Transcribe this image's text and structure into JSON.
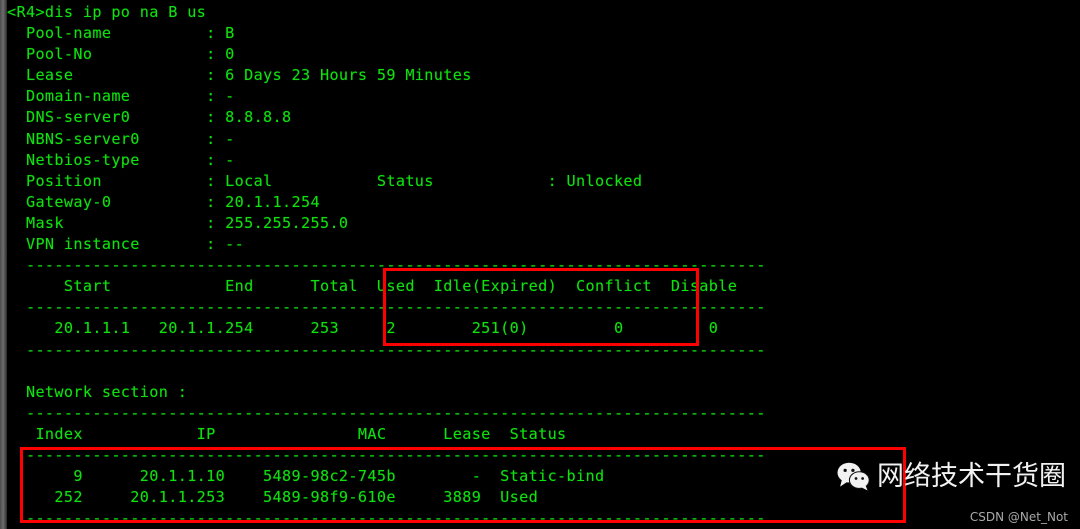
{
  "terminal": {
    "prompt": "<R4>",
    "command": "dis ip po na B us",
    "command_line": "<R4>dis ip po na B us",
    "text_color": "#10e010",
    "background_color": "#000000"
  },
  "pool": {
    "fields": [
      {
        "label": "Pool-name",
        "value": "B"
      },
      {
        "label": "Pool-No",
        "value": "0"
      },
      {
        "label": "Lease",
        "value": "6 Days 23 Hours 59 Minutes"
      },
      {
        "label": "Domain-name",
        "value": "-"
      },
      {
        "label": "DNS-server0",
        "value": "8.8.8.8"
      },
      {
        "label": "NBNS-server0",
        "value": "-"
      },
      {
        "label": "Netbios-type",
        "value": "-"
      },
      {
        "label": "Position",
        "value": "Local"
      },
      {
        "label": "Gateway-0",
        "value": "20.1.1.254"
      },
      {
        "label": "Mask",
        "value": "255.255.255.0"
      },
      {
        "label": "VPN instance",
        "value": "--"
      }
    ],
    "status_label": "Status",
    "status_value": "Unlocked"
  },
  "usage_table": {
    "headers": [
      "Start",
      "End",
      "Total",
      "Used",
      "Idle(Expired)",
      "Conflict",
      "Disable"
    ],
    "rows": [
      {
        "start": "20.1.1.1",
        "end": "20.1.1.254",
        "total": "253",
        "used": "2",
        "idle_expired": "251(0)",
        "conflict": "0",
        "disable": "0"
      }
    ]
  },
  "network_section": {
    "title": "Network section :",
    "headers": [
      "Index",
      "IP",
      "MAC",
      "Lease",
      "Status"
    ],
    "rows": [
      {
        "index": "9",
        "ip": "20.1.1.10",
        "mac": "5489-98c2-745b",
        "lease": "-",
        "status": "Static-bind"
      },
      {
        "index": "252",
        "ip": "20.1.1.253",
        "mac": "5489-98f9-610e",
        "lease": "3889",
        "status": "Used"
      }
    ]
  },
  "annotations": {
    "color": "#fe0000",
    "boxes": [
      {
        "name": "usage-counters-highlight",
        "targets": "Total / Used / Idle(Expired)"
      },
      {
        "name": "network-leases-highlight",
        "targets": "Index / IP / MAC / Lease / Status rows"
      }
    ]
  },
  "watermark": {
    "logo": "wechat-icon",
    "text": "网络技术干货圈",
    "credit": "CSDN @Net_Not",
    "text_color": "#f2f2f2",
    "credit_color": "#a9a9a9"
  },
  "console_text": "<R4>dis ip po na B us\n  Pool-name          : B\n  Pool-No            : 0\n  Lease              : 6 Days 23 Hours 59 Minutes\n  Domain-name        : -\n  DNS-server0        : 8.8.8.8\n  NBNS-server0       : -\n  Netbios-type       : -\n  Position           : Local           Status            : Unlocked\n  Gateway-0          : 20.1.1.254\n  Mask               : 255.255.255.0\n  VPN instance       : --\n  ------------------------------------------------------------------------------\n      Start            End      Total  Used  Idle(Expired)  Conflict  Disable\n  ------------------------------------------------------------------------------\n     20.1.1.1   20.1.1.254      253     2        251(0)         0         0\n  ------------------------------------------------------------------------------\n\n  Network section :\n  ------------------------------------------------------------------------------\n   Index            IP               MAC      Lease  Status\n  ------------------------------------------------------------------------------\n       9      20.1.1.10    5489-98c2-745b        -  Static-bind\n     252     20.1.1.253    5489-98f9-610e     3889  Used\n  ------------------------------------------------------------------------------"
}
